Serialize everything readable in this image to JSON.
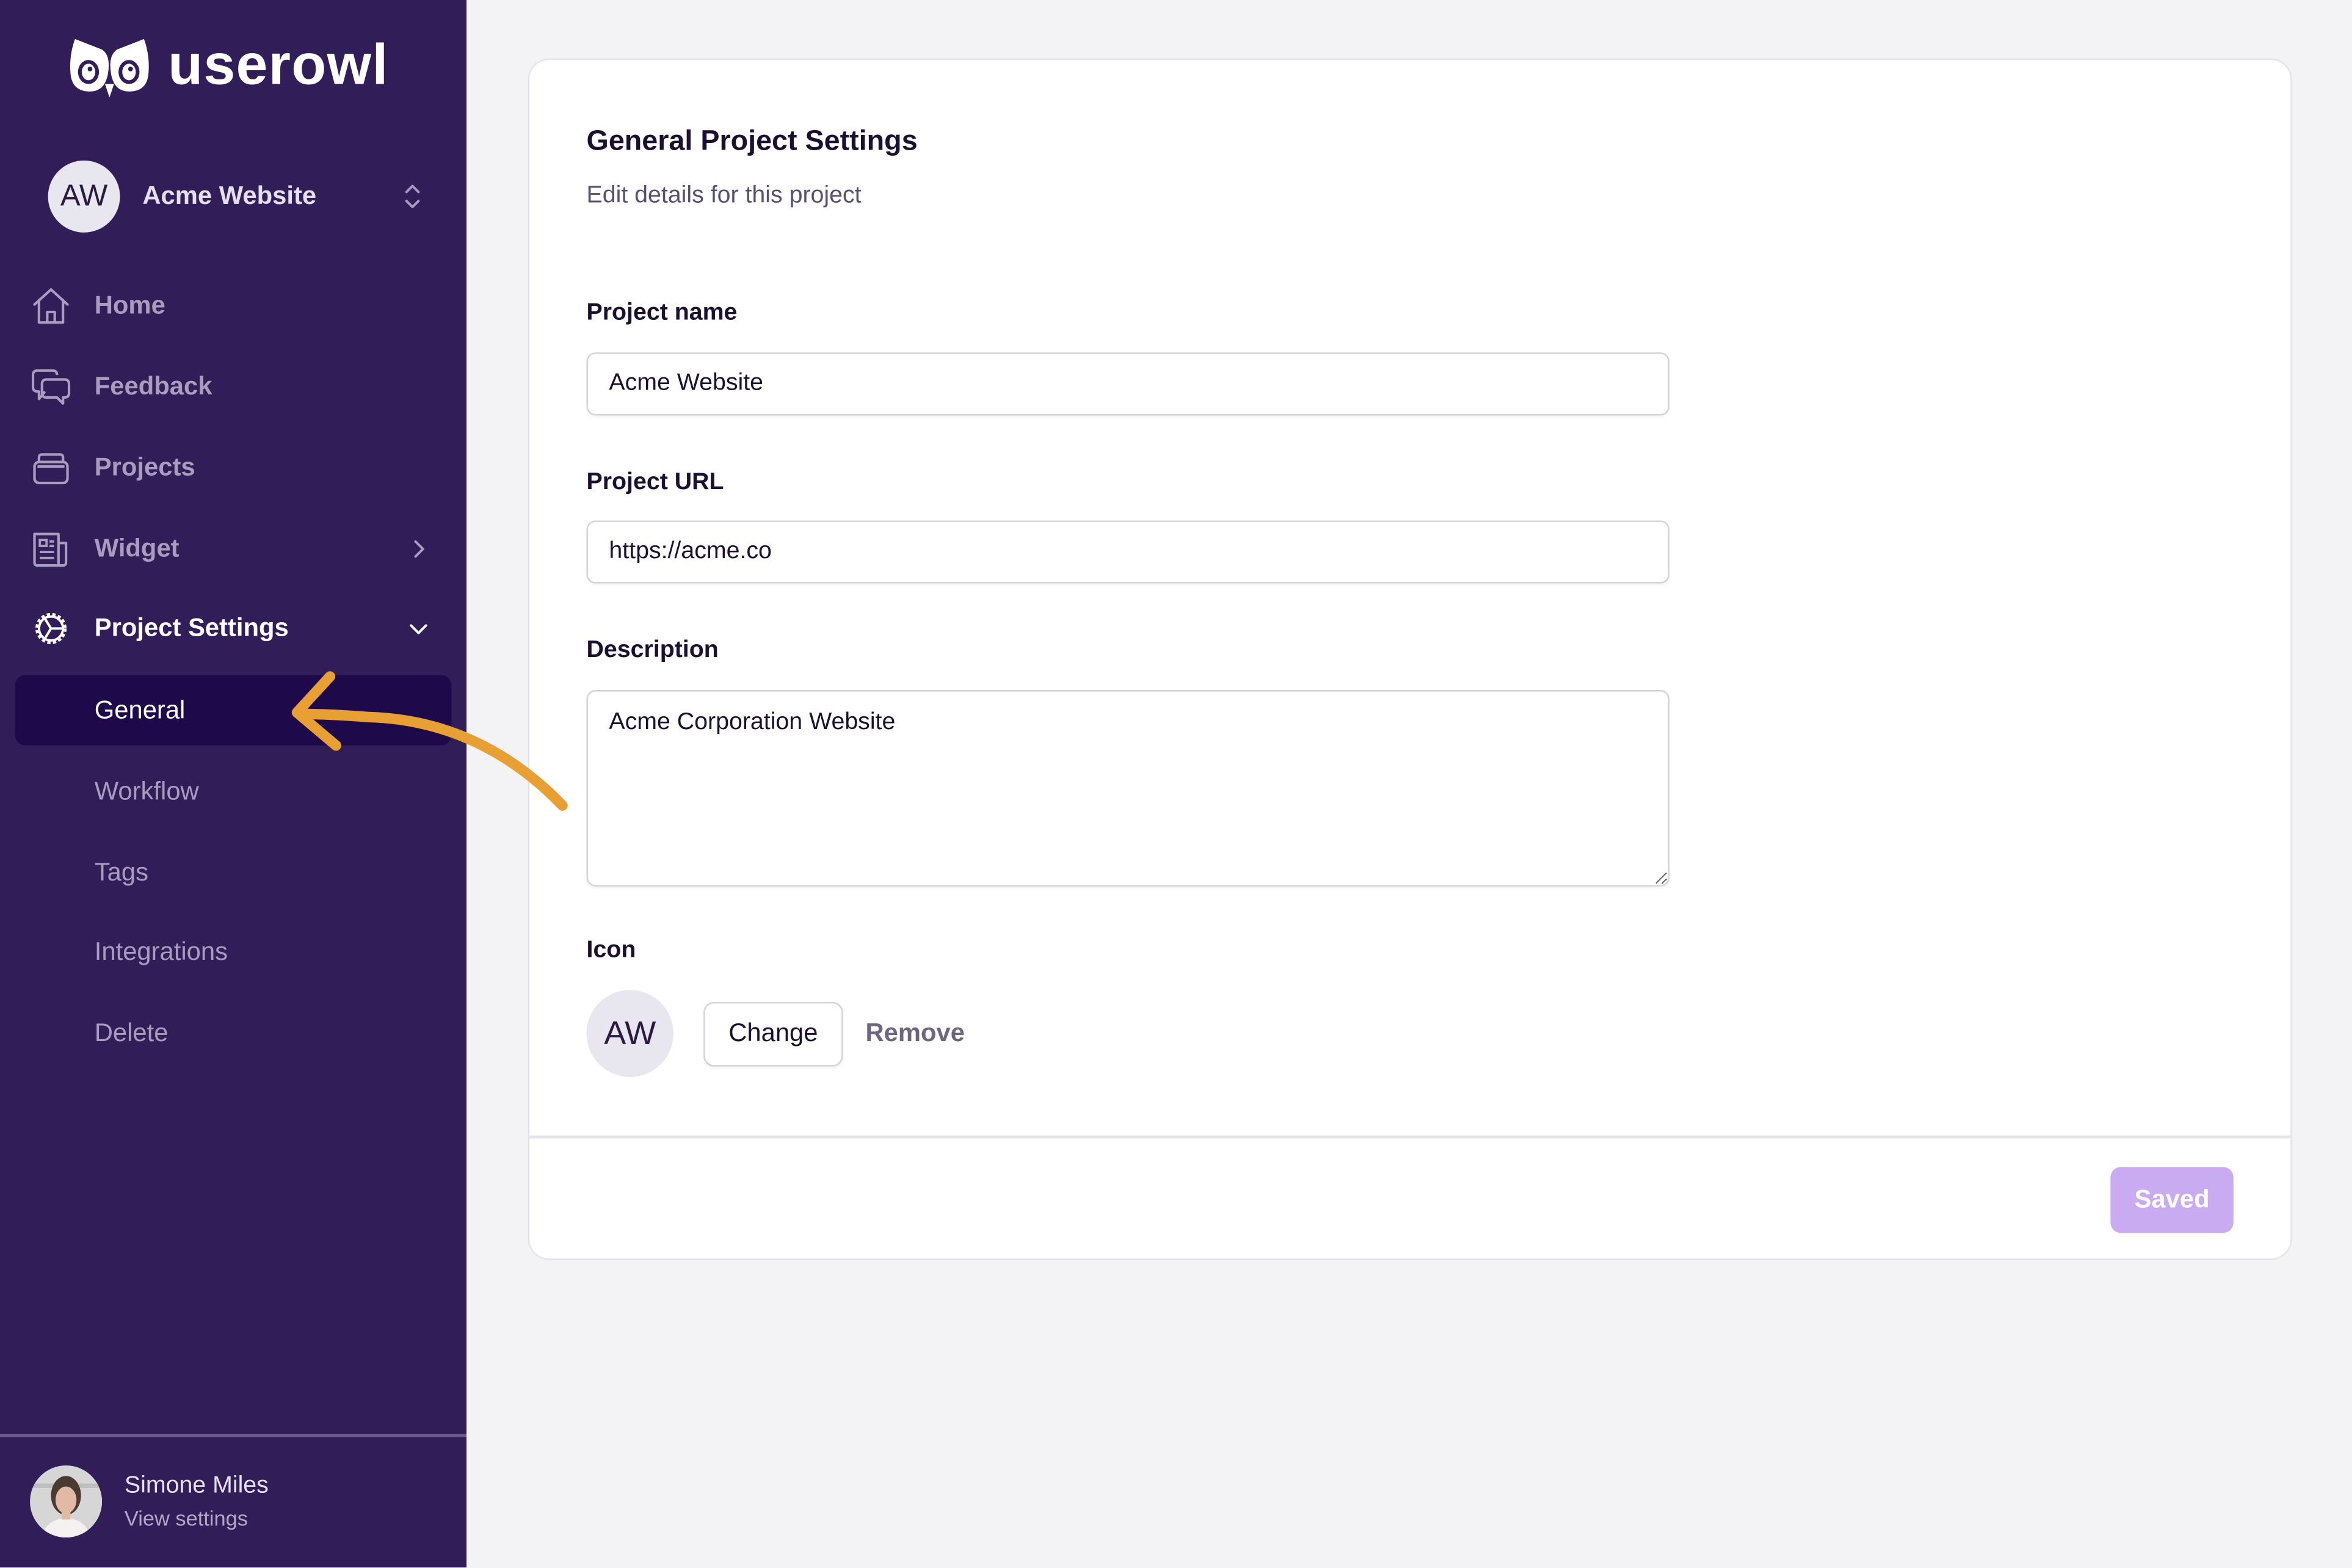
{
  "brand": {
    "name": "userowl",
    "logo_icon": "owl-logo-icon"
  },
  "project_switcher": {
    "initials": "AW",
    "name": "Acme Website",
    "icon": "chevron-up-down-icon"
  },
  "sidebar": {
    "nav": [
      {
        "label": "Home",
        "icon": "home-icon"
      },
      {
        "label": "Feedback",
        "icon": "chat-bubbles-icon"
      },
      {
        "label": "Projects",
        "icon": "stack-icon"
      },
      {
        "label": "Widget",
        "icon": "newspaper-icon",
        "trailing": "chevron-right-icon"
      },
      {
        "label": "Project Settings",
        "icon": "gear-icon",
        "trailing": "chevron-down-icon",
        "expanded": true
      }
    ],
    "sub_items": [
      {
        "label": "General",
        "active": true
      },
      {
        "label": "Workflow"
      },
      {
        "label": "Tags"
      },
      {
        "label": "Integrations"
      },
      {
        "label": "Delete"
      }
    ]
  },
  "user": {
    "name": "Simone Miles",
    "subtitle": "View settings"
  },
  "main": {
    "title": "General Project Settings",
    "subtitle": "Edit details for this project",
    "fields": {
      "project_name": {
        "label": "Project name",
        "value": "Acme Website"
      },
      "project_url": {
        "label": "Project URL",
        "value": "https://acme.co"
      },
      "description": {
        "label": "Description",
        "value": "Acme Corporation Website"
      }
    },
    "icon_section": {
      "label": "Icon",
      "initials": "AW",
      "change_label": "Change",
      "remove_label": "Remove"
    },
    "save_button": {
      "label": "Saved",
      "state": "disabled"
    }
  },
  "annotation": {
    "type": "arrow",
    "points_to": "General",
    "color": "#e8a035"
  },
  "colors": {
    "sidebar_bg": "#311d58",
    "active_bg": "#1e0a4b",
    "saved_button": "#c8abf0",
    "page_bg": "#f3f3f6"
  }
}
